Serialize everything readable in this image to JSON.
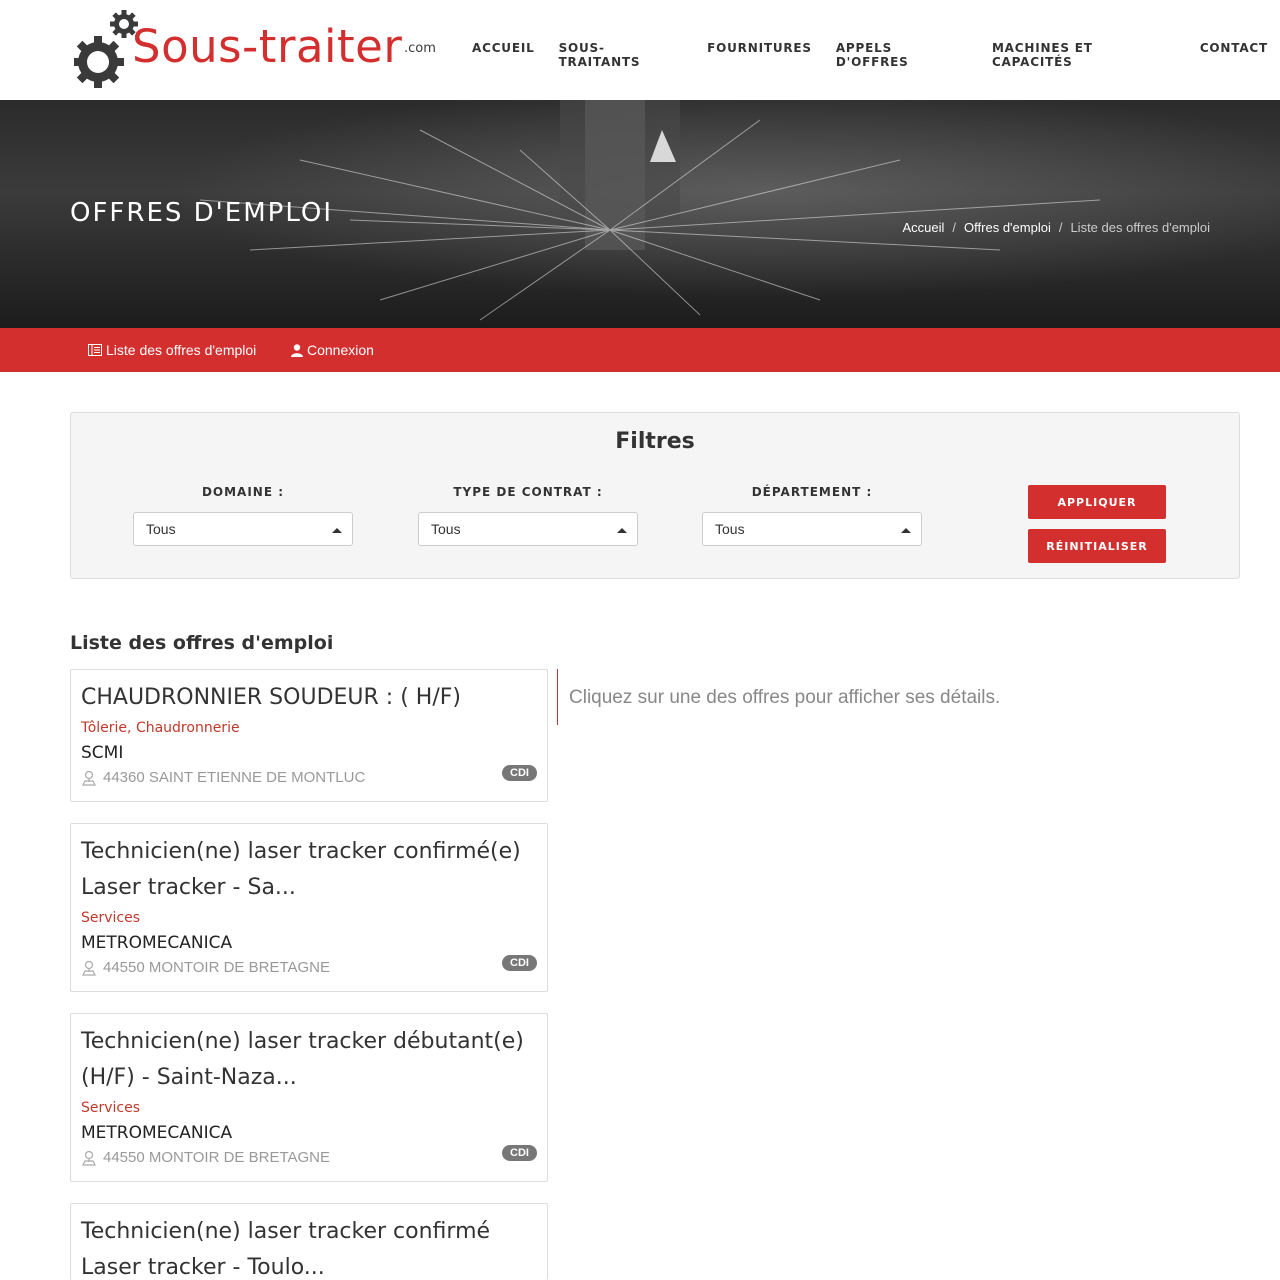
{
  "logo": {
    "text": "Sous-traiter",
    "tld": ".com"
  },
  "nav": [
    {
      "label": "ACCUEIL"
    },
    {
      "label": "SOUS-TRAITANTS"
    },
    {
      "label": "FOURNITURES"
    },
    {
      "label": "APPELS D'OFFRES"
    },
    {
      "label": "MACHINES ET CAPACITÉS"
    },
    {
      "label": "CONTACT"
    }
  ],
  "hero": {
    "title": "OFFRES D'EMPLOI",
    "breadcrumb": [
      "Accueil",
      "Offres d'emploi",
      "Liste des offres d'emploi"
    ],
    "separator": "/"
  },
  "subnav": {
    "list_label": "Liste des offres d'emploi",
    "login_label": "Connexion"
  },
  "filters": {
    "title": "Filtres",
    "domaine": {
      "label": "DOMAINE :",
      "value": "Tous"
    },
    "contrat": {
      "label": "TYPE DE CONTRAT :",
      "value": "Tous"
    },
    "departement": {
      "label": "DÉPARTEMENT :",
      "value": "Tous"
    },
    "apply_label": "APPLIQUER",
    "reset_label": "RÉINITIALISER"
  },
  "list": {
    "heading": "Liste des offres d'emploi",
    "detail_hint": "Cliquez sur une des offres pour afficher ses détails.",
    "offers": [
      {
        "title": "CHAUDRONNIER SOUDEUR : ( H/F)",
        "domain": "Tôlerie, Chaudronnerie",
        "company": "SCMI",
        "location": "44360 SAINT ETIENNE DE MONTLUC",
        "contract": "CDI"
      },
      {
        "title": "Technicien(ne) laser tracker confirmé(e) Laser tracker - Sa...",
        "domain": "Services",
        "company": "METROMECANICA",
        "location": "44550 MONTOIR DE BRETAGNE",
        "contract": "CDI"
      },
      {
        "title": "Technicien(ne) laser tracker débutant(e) (H/F) - Saint-Naza...",
        "domain": "Services",
        "company": "METROMECANICA",
        "location": "44550 MONTOIR DE BRETAGNE",
        "contract": "CDI"
      },
      {
        "title": "Technicien(ne) laser tracker confirmé Laser tracker - Toulo...",
        "domain": "",
        "company": "",
        "location": "",
        "contract": ""
      }
    ]
  },
  "colors": {
    "brand_red": "#d42f2f",
    "domain_red": "#c0392b"
  }
}
